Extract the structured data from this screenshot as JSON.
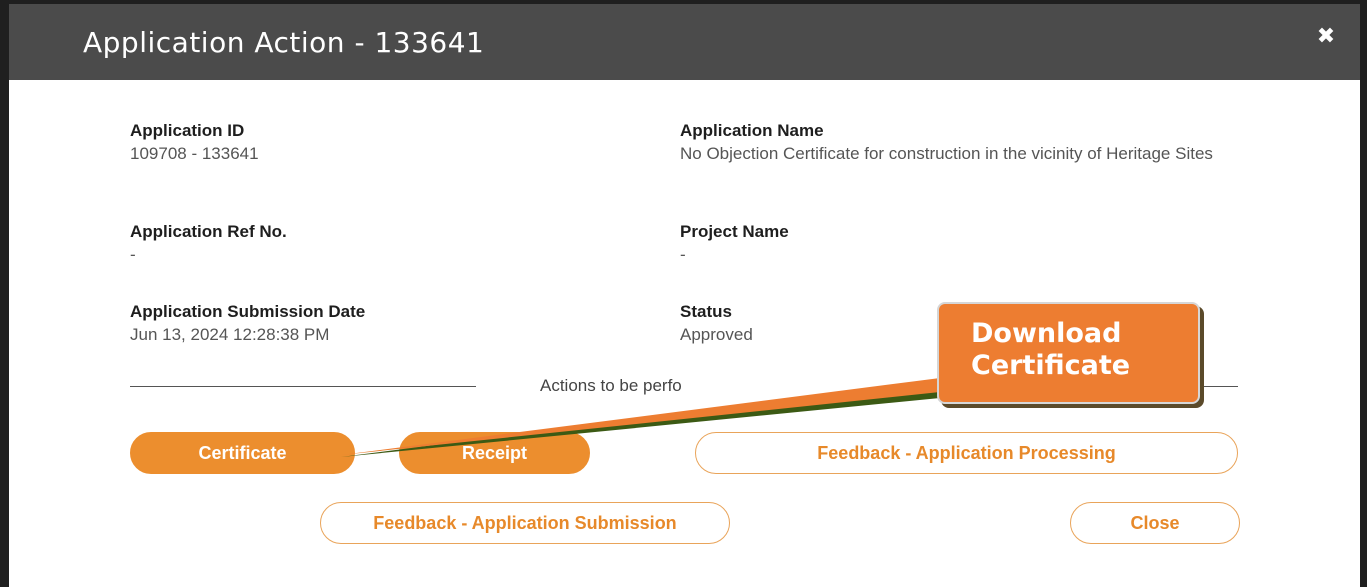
{
  "modal": {
    "title": "Application Action - 133641",
    "close_icon": "close-icon"
  },
  "fields": {
    "app_id": {
      "label": "Application ID",
      "value": "109708 - 133641"
    },
    "app_name": {
      "label": "Application Name",
      "value": "No Objection Certificate for construction in the vicinity of Heritage Sites"
    },
    "ref_no": {
      "label": "Application Ref No.",
      "value": "-"
    },
    "project": {
      "label": "Project Name",
      "value": "-"
    },
    "submission": {
      "label": "Application Submission Date",
      "value": "Jun 13, 2024 12:28:38 PM"
    },
    "status": {
      "label": "Status",
      "value": "Approved"
    }
  },
  "actions": {
    "heading": "Actions to be perfo",
    "certificate": "Certificate",
    "receipt": "Receipt",
    "feedback_processing": "Feedback - Application Processing",
    "feedback_submission": "Feedback - Application Submission",
    "close": "Close"
  },
  "callout": {
    "line1": "Download",
    "line2": "Certificate"
  },
  "colors": {
    "header": "#4b4b4b",
    "accent": "#ec8e2e",
    "callout": "#ed7d31"
  }
}
